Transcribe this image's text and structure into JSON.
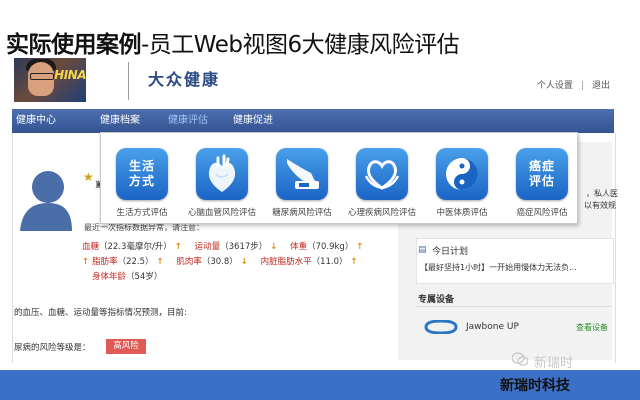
{
  "slide": {
    "title_part1": "实际使用案例",
    "title_part2": "-员工Web视图6大健康风险评估"
  },
  "header": {
    "brand": "大众健康",
    "links": [
      "个人设置",
      "|",
      "退出"
    ],
    "photo_banner": "HINA"
  },
  "nav": {
    "items": [
      {
        "label": "健康中心",
        "active": false
      },
      {
        "label": "健康档案",
        "active": false
      },
      {
        "label": "健康评估",
        "active": true
      },
      {
        "label": "健康促进",
        "active": false
      }
    ]
  },
  "popup": {
    "tiles": [
      {
        "title": "生活方式",
        "label": "生活方式评估",
        "icon": "lifestyle-text-icon"
      },
      {
        "title": "",
        "label": "心脑血管风险评估",
        "icon": "heart-organ-icon"
      },
      {
        "title": "",
        "label": "糖尿病风险评估",
        "icon": "glucose-meter-icon"
      },
      {
        "title": "",
        "label": "心理疾病风险评估",
        "icon": "heart-hands-icon"
      },
      {
        "title": "",
        "label": "中医体质评估",
        "icon": "yin-yang-icon"
      },
      {
        "title": "癌症评估",
        "label": "癌症风险评估",
        "icon": "cancer-text-icon"
      }
    ]
  },
  "profile": {
    "recent": "最近一次指标数据异常，请注意：",
    "metrics": [
      {
        "name": "血糖",
        "value": "（22.3毫摩尔/升）",
        "trend": "up"
      },
      {
        "name": "运动量",
        "value": "（3617步）",
        "trend": "down"
      },
      {
        "name": "体重",
        "value": "（70.9kg）",
        "trend": "up"
      },
      {
        "name": "脂肪率",
        "value": "（22.5）",
        "trend": "up"
      },
      {
        "name": "肌肉率",
        "value": "（30.8）",
        "trend": "down"
      },
      {
        "name": "内脏脂肪水平",
        "value": "（11.0）",
        "trend": "up"
      },
      {
        "name": "身体年龄",
        "value": "（54岁）",
        "trend": ""
      }
    ],
    "description": "的血压、血糖、运动量等指标情况预测，目前:",
    "risk_label": "尿病的风险等级是：",
    "risk_level": "高风险"
  },
  "side_panel": {
    "line1": "，私人医",
    "line2": "以有效规",
    "today_title": "今日计划",
    "today_text": "【最好坚持1小时】一开始用慢体力无法负...",
    "devices_title": "专属设备",
    "device_name": "Jawbone UP",
    "device_link": "查看设备"
  },
  "footer": {
    "brand": "新瑞时科技",
    "watermark": "新瑞时"
  },
  "colors": {
    "nav": "#3d5c9c",
    "tile": "#2a7ed8",
    "risk": "#e05a55",
    "band": "#3c70c6",
    "metric_name": "#c0281e",
    "arrow": "#e08a12"
  }
}
